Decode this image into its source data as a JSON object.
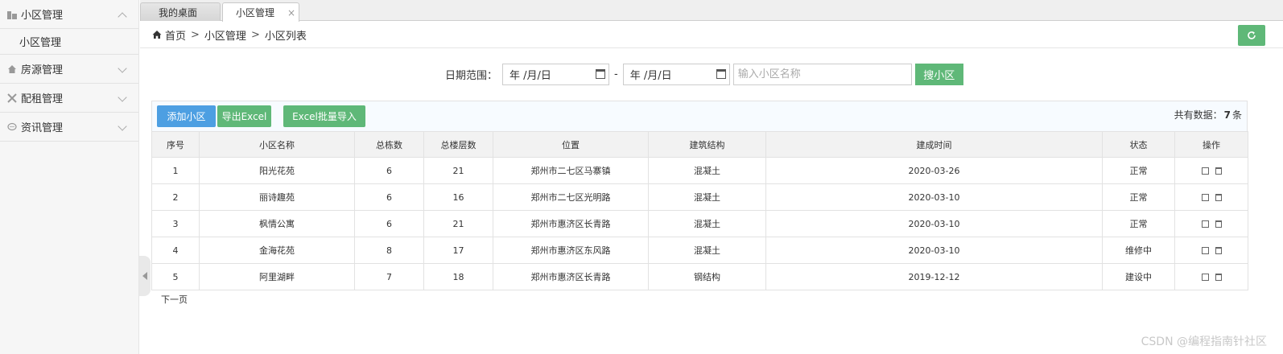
{
  "sidebar": {
    "menus": [
      {
        "label": "小区管理",
        "icon": "building-icon",
        "expanded": true
      },
      {
        "label": "房源管理",
        "icon": "home-icon",
        "expanded": false
      },
      {
        "label": "配租管理",
        "icon": "tools-icon",
        "expanded": false
      },
      {
        "label": "资讯管理",
        "icon": "chat-icon",
        "expanded": false
      }
    ],
    "submenu": {
      "label": "小区管理"
    }
  },
  "tabs": [
    {
      "label": "我的桌面"
    },
    {
      "label": "小区管理",
      "close": "×"
    }
  ],
  "breadcrumb": {
    "home": "首页",
    "sep": ">",
    "level1": "小区管理",
    "level2": "小区列表"
  },
  "search": {
    "date_label": "日期范围：",
    "date_start": "年 /月/日",
    "date_end": "年 /月/日",
    "dash": "-",
    "name_placeholder": "输入小区名称",
    "button": "搜小区"
  },
  "toolbar": {
    "add": "添加小区",
    "export": "导出Excel",
    "import": "Excel批量导入",
    "total_prefix": "共有数据：",
    "total_count": "7",
    "total_suffix": "条"
  },
  "table": {
    "headers": [
      "序号",
      "小区名称",
      "总栋数",
      "总楼层数",
      "位置",
      "建筑结构",
      "建成时间",
      "状态",
      "操作"
    ],
    "rows": [
      [
        "1",
        "阳光花苑",
        "6",
        "21",
        "郑州市二七区马寨镇",
        "混凝土",
        "2020-03-26",
        "正常"
      ],
      [
        "2",
        "丽诗趣苑",
        "6",
        "16",
        "郑州市二七区光明路",
        "混凝土",
        "2020-03-10",
        "正常"
      ],
      [
        "3",
        "枫情公寓",
        "6",
        "21",
        "郑州市惠济区长青路",
        "混凝土",
        "2020-03-10",
        "正常"
      ],
      [
        "4",
        "金海花苑",
        "8",
        "17",
        "郑州市惠济区东风路",
        "混凝土",
        "2020-03-10",
        "维修中"
      ],
      [
        "5",
        "阿里湖畔",
        "7",
        "18",
        "郑州市惠济区长青路",
        "钢结构",
        "2019-12-12",
        "建设中"
      ]
    ]
  },
  "pager": {
    "next": "下一页"
  },
  "watermark": "CSDN @编程指南针社区",
  "colors": {
    "green": "#5fb878",
    "blue": "#4d9fe2"
  }
}
